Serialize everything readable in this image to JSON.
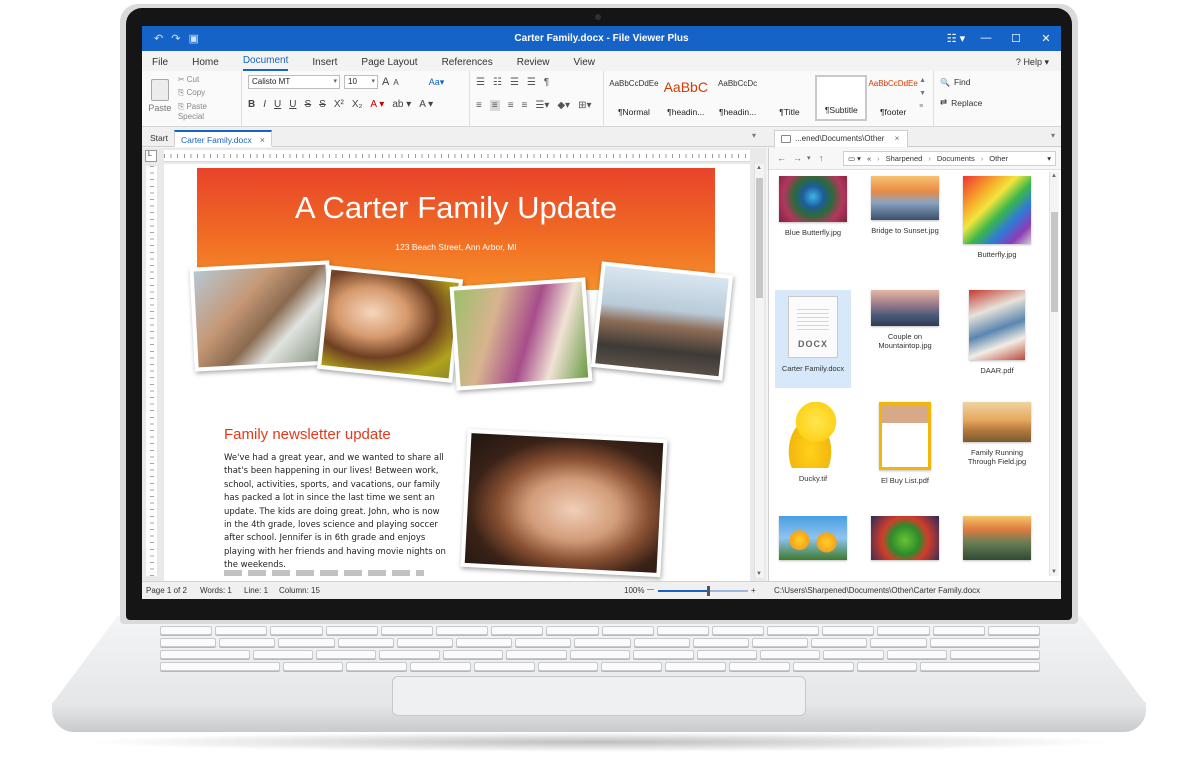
{
  "window": {
    "title": "Carter Family.docx - File Viewer Plus",
    "minimize_glyph": "—",
    "maximize_glyph": "☐",
    "close_glyph": "✕",
    "settings_glyph": "☷ ▾"
  },
  "quick_access": {
    "undo": "↶",
    "redo": "↷",
    "save": "▣"
  },
  "menu": {
    "items": [
      "File",
      "Home",
      "Document",
      "Insert",
      "Page Layout",
      "References",
      "Review",
      "View"
    ],
    "active": "Document",
    "help": "Help",
    "help_glyph": "?",
    "help_suffix": "▾"
  },
  "clipboard": {
    "paste": "Paste",
    "cut": "Cut",
    "copy": "Copy",
    "paste_special": "Paste Special"
  },
  "font": {
    "name": "Calisto MT",
    "size": "10",
    "grow": "A",
    "shrink": "A",
    "case": "Aa",
    "case_suffix": "▾",
    "formats": [
      "B",
      "I",
      "U",
      "U",
      "S",
      "S",
      "X²",
      "X₂",
      "A ▾",
      "ab ▾",
      "A ▾"
    ]
  },
  "paragraph": {
    "row1": [
      "☰",
      "☷",
      "☰",
      "☰",
      "¶"
    ],
    "row2": [
      "≡",
      "≡",
      "≡",
      "≡",
      "☰▾",
      "◆▾",
      "⊞▾"
    ]
  },
  "styles": [
    {
      "sample": "AaBbCcDdEe",
      "name": "¶Normal",
      "kind": "normal"
    },
    {
      "sample": "AaBbC",
      "name": "¶headin...",
      "kind": "big"
    },
    {
      "sample": "AaBbCcDc",
      "name": "¶headin...",
      "kind": "normal"
    },
    {
      "sample": "",
      "name": "¶Title",
      "kind": "normal"
    },
    {
      "sample": "",
      "name": "¶Subtitle",
      "kind": "selected"
    },
    {
      "sample": "AaBbCcDdEe",
      "name": "¶footer",
      "kind": "footer"
    }
  ],
  "style_arrows": {
    "up": "▲",
    "down": "▼",
    "more": "≡"
  },
  "editing": {
    "find": "Find",
    "replace": "Replace",
    "find_glyph": "🔍",
    "replace_glyph": "⇄"
  },
  "tabs": {
    "start": "Start",
    "current": "Carter Family.docx",
    "close": "×",
    "menu": "▾"
  },
  "file_panel": {
    "tab": "...ened\\Documents\\Other",
    "tab_close": "×",
    "tab_menu": "▾",
    "nav": [
      "←",
      "→",
      "▾",
      "↑",
      "▭ ▾",
      "«"
    ],
    "path": [
      "Sharpened",
      "Documents",
      "Other"
    ],
    "path_sep": "›",
    "path_dropdown": "▾",
    "files": [
      {
        "name": "Blue Butterfly.jpg",
        "thumb": "butterfly-blue"
      },
      {
        "name": "Bridge to Sunset.jpg",
        "thumb": "bridge"
      },
      {
        "name": "Butterfly.jpg",
        "thumb": "butterfly-rainbow"
      },
      {
        "name": "Carter Family.docx",
        "thumb": "docx",
        "selected": true
      },
      {
        "name": "Couple on Mountaintop.jpg",
        "thumb": "mountain"
      },
      {
        "name": "DAAR.pdf",
        "thumb": "pdf-collage"
      },
      {
        "name": "Ducky.tif",
        "thumb": "duck"
      },
      {
        "name": "El Buy List.pdf",
        "thumb": "pdf-list"
      },
      {
        "name": "Family Running Through Field.jpg",
        "thumb": "field"
      },
      {
        "name": "",
        "thumb": "sunflowers"
      },
      {
        "name": "",
        "thumb": "frog"
      },
      {
        "name": "",
        "thumb": "valley"
      }
    ],
    "docx_label": "DOCX"
  },
  "document": {
    "banner_title": "A Carter Family Update",
    "banner_subtitle": "123 Beach Street, Ann Arbor, MI",
    "heading": "Family newsletter update",
    "body": "We've had a great year, and we wanted to share all\nthat's been happening in our lives!  Between work,\nschool, activities, sports, and vacations, our family\nhas packed a lot in since the last time we sent an\nupdate.  The kids are doing great.  John, who is now\nin the 4th grade, loves science and playing soccer\nafter school.  Jennifer is in 6th grade and enjoys\nplaying with her friends and having movie nights on\nthe weekends.",
    "ruler_corner": "L"
  },
  "status": {
    "page": "Page 1 of 2",
    "words": "Words: 1",
    "line": "Line: 1",
    "column": "Column: 15",
    "zoom": "100%",
    "zoom_minus": "—",
    "zoom_plus": "+",
    "zoom_level": 0.55,
    "file_path": "C:\\Users\\Sharpened\\Documents\\Other\\Carter Family.docx"
  }
}
